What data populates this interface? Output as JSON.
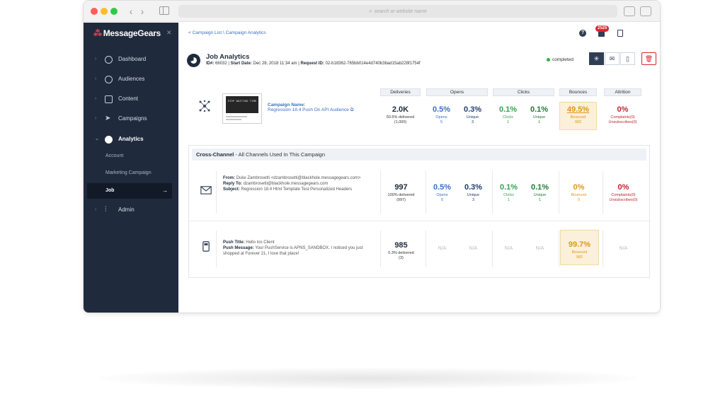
{
  "browser": {
    "url_placeholder": "search or website name"
  },
  "sidebar": {
    "logo": "MessageGears",
    "close": "✕",
    "items": [
      {
        "label": "Dashboard"
      },
      {
        "label": "Audiences"
      },
      {
        "label": "Content"
      },
      {
        "label": "Campaigns"
      },
      {
        "label": "Analytics"
      },
      {
        "label": "Admin"
      }
    ],
    "sub_items": [
      {
        "label": "Account"
      },
      {
        "label": "Marketing Campaign"
      },
      {
        "label": "Job"
      }
    ]
  },
  "topbar": {
    "breadcrumb": "< Campaign List \\ Campaign Analytics",
    "help": "?",
    "notifications": "2525"
  },
  "job": {
    "title": "Job Analytics",
    "id_label": "ID#:",
    "id": "66032",
    "start_label": "Start Date:",
    "start": "Dec 28, 2018 11:34 am",
    "request_label": "Request ID:",
    "request": "02-b18362-765bb014e4d740b3bad15ab228f1754f",
    "status": "completed"
  },
  "campaign": {
    "name_label": "Campaign Name:",
    "name": "Regression 18.4 Push On API Audience",
    "thumb_text": "STOP WAITING TIME"
  },
  "columns": [
    "Deliveries",
    "Opens",
    "Clicks",
    "Bounces",
    "Attrition"
  ],
  "summary": {
    "deliveries": {
      "value": "2.0K",
      "line1": "50.5% delivered",
      "line2": "(1,000)"
    },
    "opens": {
      "value": "0.5%",
      "label": "Opens",
      "count": "5"
    },
    "opens_unique": {
      "value": "0.3%",
      "label": "Unique",
      "count": "3"
    },
    "clicks": {
      "value": "0.1%",
      "label": "Clicks",
      "count": "1"
    },
    "clicks_unique": {
      "value": "0.1%",
      "label": "Unique",
      "count": "1"
    },
    "bounces": {
      "value": "49.5%",
      "label": "Bounced",
      "count": "982"
    },
    "attrition": {
      "value": "0%",
      "line1": "Complaints(0)",
      "line2": "Unsubscribes(0)"
    }
  },
  "cross_channel": {
    "title": "Cross-Channel",
    "subtitle": " - All Channels Used In This Campaign",
    "email": {
      "from_label": "From:",
      "from": "Duke Zambrosetti <dzambrosetti@blackhole.messagegears.com>",
      "reply_label": "Reply To:",
      "reply": "dzambrosetti@blackhole.messagegears.com",
      "subject_label": "Subject:",
      "subject": "Regression 18.4 Html Template Test Personalized Headers",
      "deliveries": {
        "value": "997",
        "line1": "100% delivered",
        "line2": "(997)"
      },
      "opens": {
        "value": "0.5%",
        "label": "Opens",
        "count": "5"
      },
      "opens_unique": {
        "value": "0.3%",
        "label": "Unique",
        "count": "3"
      },
      "clicks": {
        "value": "0.1%",
        "label": "Clicks",
        "count": "1"
      },
      "clicks_unique": {
        "value": "0.1%",
        "label": "Unique",
        "count": "1"
      },
      "bounces": {
        "value": "0%",
        "label": "Bounced",
        "count": "0"
      },
      "attrition": {
        "value": "0%",
        "line1": "Complaints(0)",
        "line2": "Unsubscribes(0)"
      }
    },
    "push": {
      "title_label": "Push Title:",
      "title": "Hello Ios Client",
      "message_label": "Push Message:",
      "message": "Your PushService is APNS_SANDBOX. I noticed you just shopped at Forever 21, I love that place!",
      "deliveries": {
        "value": "985",
        "line1": "0.3% delivered",
        "line2": "(3)"
      },
      "na": "N/A",
      "bounces": {
        "value": "99.7%",
        "label": "Bounced",
        "count": "982"
      }
    }
  },
  "colors": {
    "sidebar": "#1f2a3d",
    "blue": "#3b6fc4",
    "green": "#2fa44f",
    "orange": "#e0951a",
    "red": "#c0262e",
    "navy": "#1f2a3d"
  }
}
